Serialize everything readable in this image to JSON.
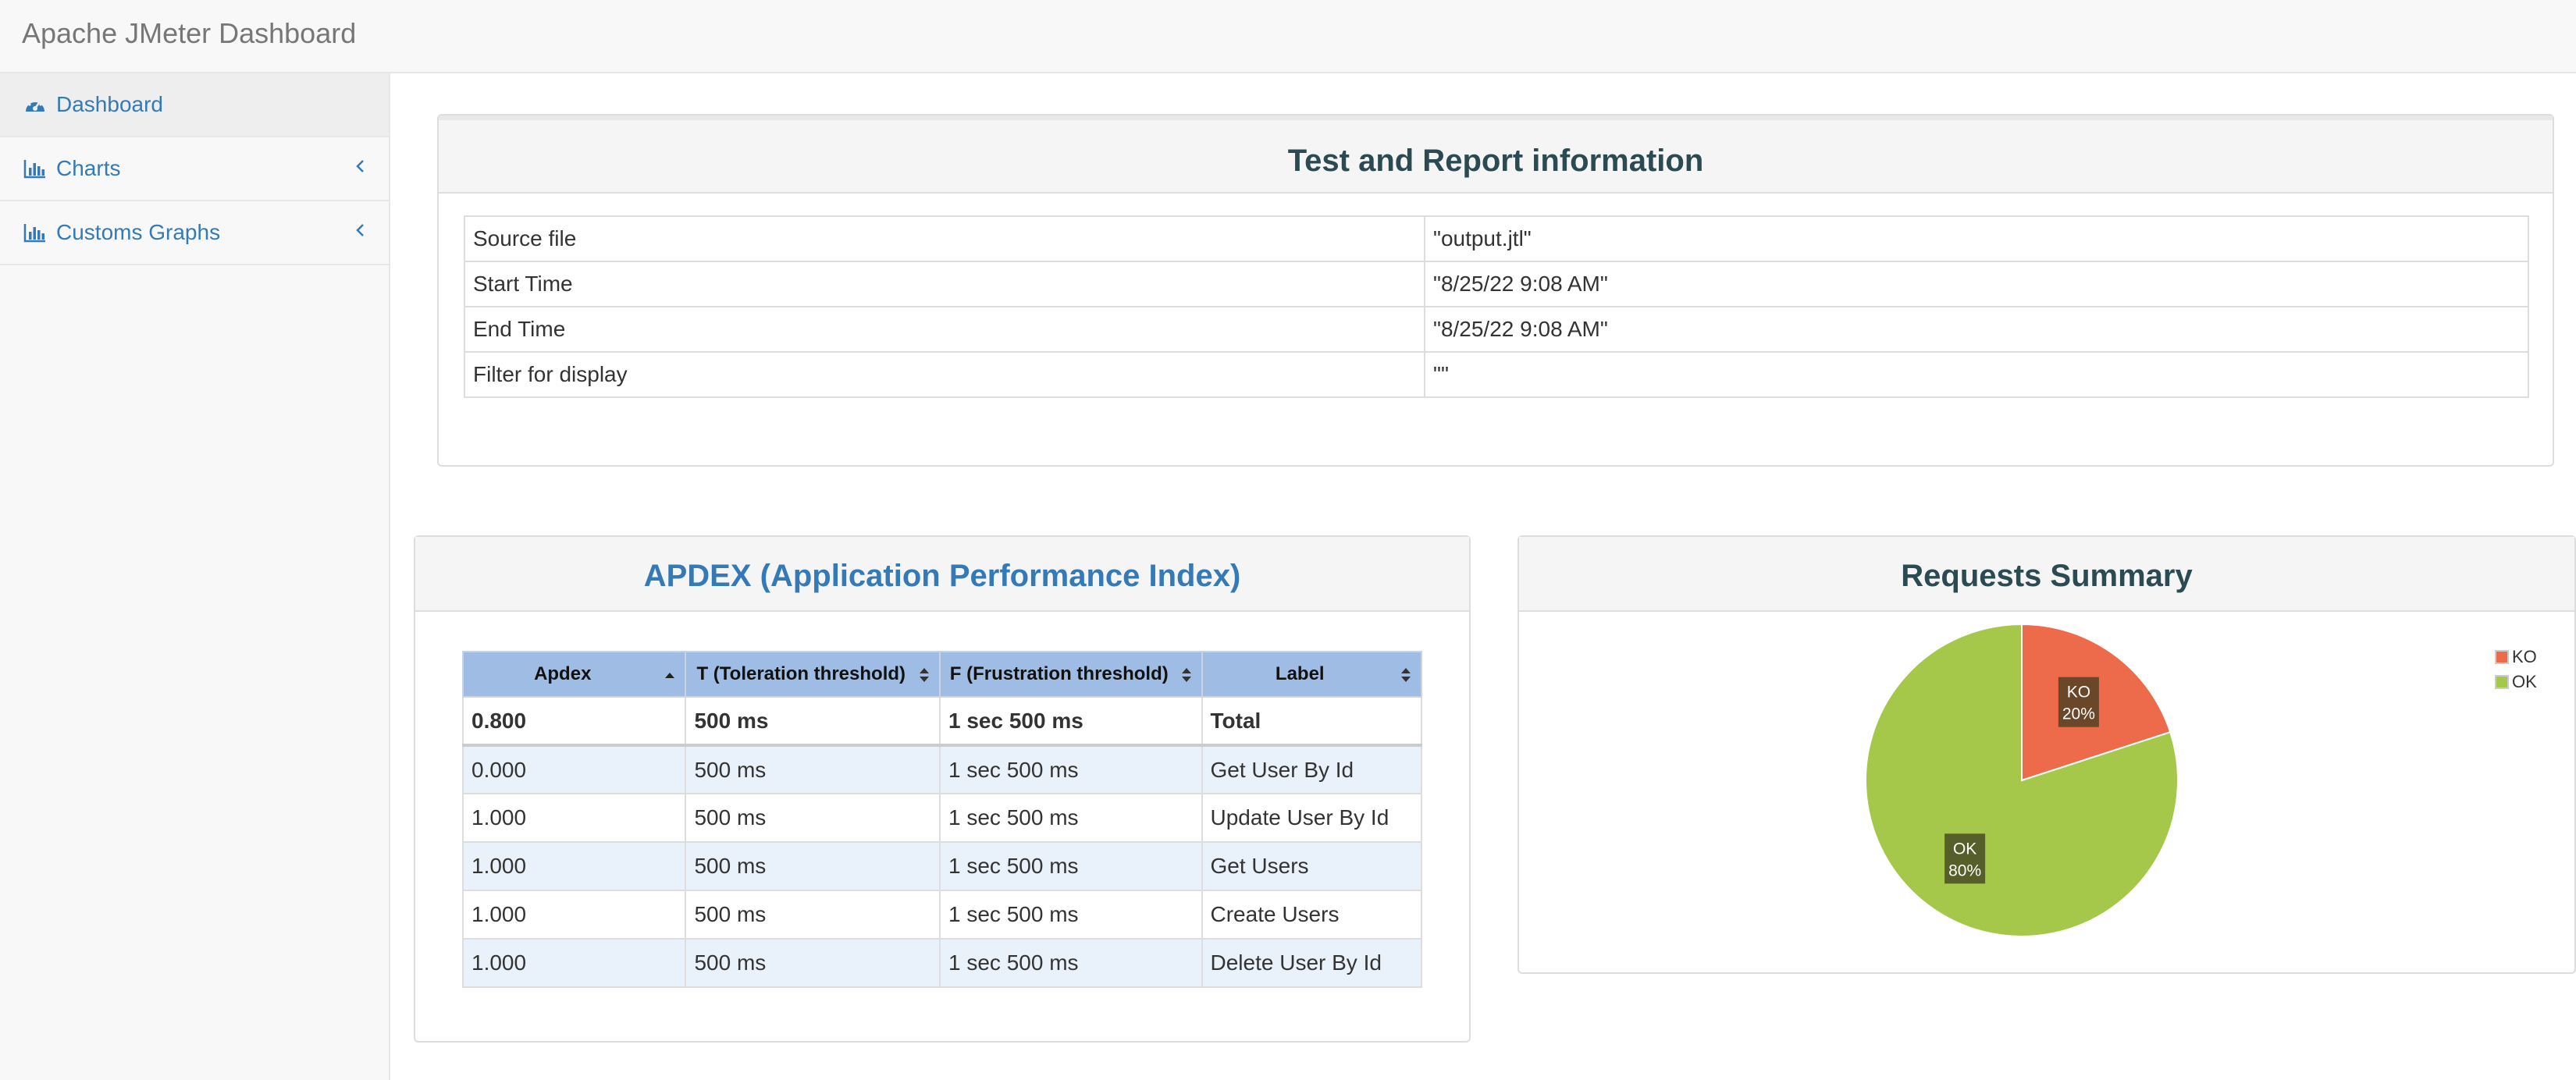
{
  "app": {
    "title": "Apache JMeter Dashboard"
  },
  "sidebar": {
    "items": [
      {
        "label": "Dashboard",
        "icon": "dashboard-icon",
        "active": true
      },
      {
        "label": "Charts",
        "icon": "bar-chart-icon",
        "expandable": true
      },
      {
        "label": "Customs Graphs",
        "icon": "bar-chart-icon",
        "expandable": true
      }
    ]
  },
  "test_info": {
    "title": "Test and Report information",
    "rows": [
      {
        "key": "Source file",
        "value": "\"output.jtl\""
      },
      {
        "key": "Start Time",
        "value": "\"8/25/22 9:08 AM\""
      },
      {
        "key": "End Time",
        "value": "\"8/25/22 9:08 AM\""
      },
      {
        "key": "Filter for display",
        "value": "\"\""
      }
    ]
  },
  "apdex": {
    "title": "APDEX (Application Performance Index)",
    "columns": [
      "Apdex",
      "T (Toleration threshold)",
      "F (Frustration threshold)",
      "Label"
    ],
    "total": [
      "0.800",
      "500 ms",
      "1 sec 500 ms",
      "Total"
    ],
    "rows": [
      [
        "0.000",
        "500 ms",
        "1 sec 500 ms",
        "Get User By Id"
      ],
      [
        "1.000",
        "500 ms",
        "1 sec 500 ms",
        "Update User By Id"
      ],
      [
        "1.000",
        "500 ms",
        "1 sec 500 ms",
        "Get Users"
      ],
      [
        "1.000",
        "500 ms",
        "1 sec 500 ms",
        "Create Users"
      ],
      [
        "1.000",
        "500 ms",
        "1 sec 500 ms",
        "Delete User By Id"
      ]
    ]
  },
  "requests_summary": {
    "title": "Requests Summary",
    "legend": [
      {
        "label": "KO",
        "color": "#ed6a4a"
      },
      {
        "label": "OK",
        "color": "#a5c84b"
      }
    ],
    "slices": [
      {
        "label": "KO",
        "percent_label": "20%",
        "value": 20,
        "color": "#ed6a4a"
      },
      {
        "label": "OK",
        "percent_label": "80%",
        "value": 80,
        "color": "#a5c84b"
      }
    ]
  },
  "colors": {
    "link": "#337ab7",
    "header_blue": "#9fbde4",
    "row_stripe": "#e9f1fa"
  }
}
